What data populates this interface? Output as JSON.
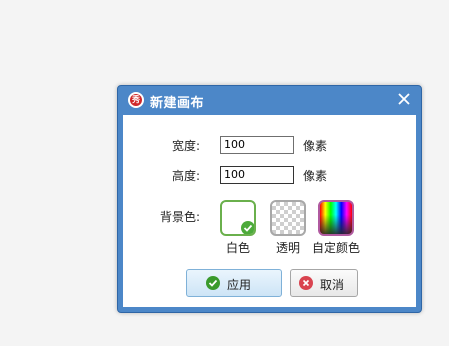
{
  "dialog": {
    "title": "新建画布",
    "width_label": "宽度:",
    "width_value": "100",
    "width_unit": "像素",
    "height_label": "高度:",
    "height_value": "100",
    "height_unit": "像素",
    "background_label": "背景色:",
    "swatches": [
      {
        "label": "白色",
        "selected": true
      },
      {
        "label": "透明",
        "selected": false
      },
      {
        "label": "自定颜色",
        "selected": false
      }
    ],
    "ok_label": "应用",
    "cancel_label": "取消"
  },
  "icons": {
    "app": "app-logo-icon",
    "close": "close-icon",
    "check": "check-icon",
    "ok": "check-circle-icon",
    "cancel": "cancel-circle-icon"
  },
  "colors": {
    "titlebar": "#4c87c8",
    "selected_border": "#6ab04c",
    "check_badge": "#4caa3a",
    "ok_icon": "#3a9a2c",
    "cancel_icon": "#d9434f"
  }
}
